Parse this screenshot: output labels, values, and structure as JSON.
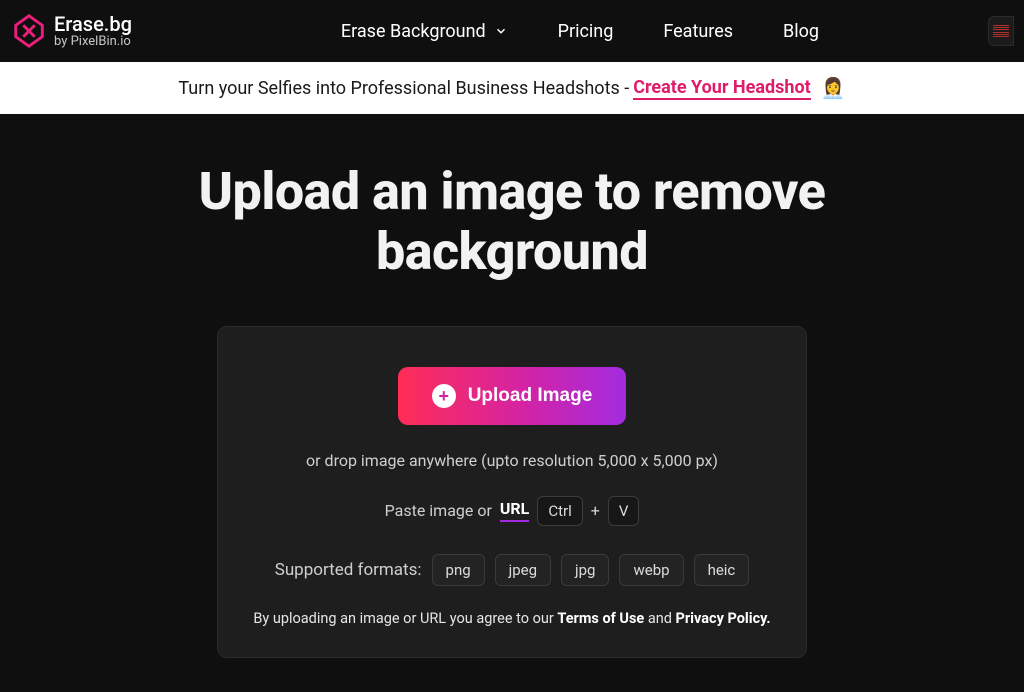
{
  "brand": {
    "title": "Erase.bg",
    "subtitle": "by PixelBin.io"
  },
  "nav": {
    "erase": "Erase Background",
    "pricing": "Pricing",
    "features": "Features",
    "blog": "Blog"
  },
  "banner": {
    "text": "Turn your Selfies into Professional Business Headshots - ",
    "link": "Create Your Headshot",
    "emoji": "👩‍💼"
  },
  "hero": {
    "title": "Upload an image to remove background"
  },
  "upload": {
    "button": "Upload Image",
    "drop": "or drop image anywhere (upto resolution 5,000 x 5,000 px)",
    "paste_prefix": "Paste image or",
    "url_label": "URL",
    "ctrl": "Ctrl",
    "v": "V",
    "plus": "+",
    "formats_label": "Supported formats:",
    "formats": [
      "png",
      "jpeg",
      "jpg",
      "webp",
      "heic"
    ],
    "terms_prefix": "By uploading an image or URL you agree to our ",
    "terms_link": "Terms of Use",
    "terms_mid": " and ",
    "privacy_link": "Privacy Policy."
  }
}
